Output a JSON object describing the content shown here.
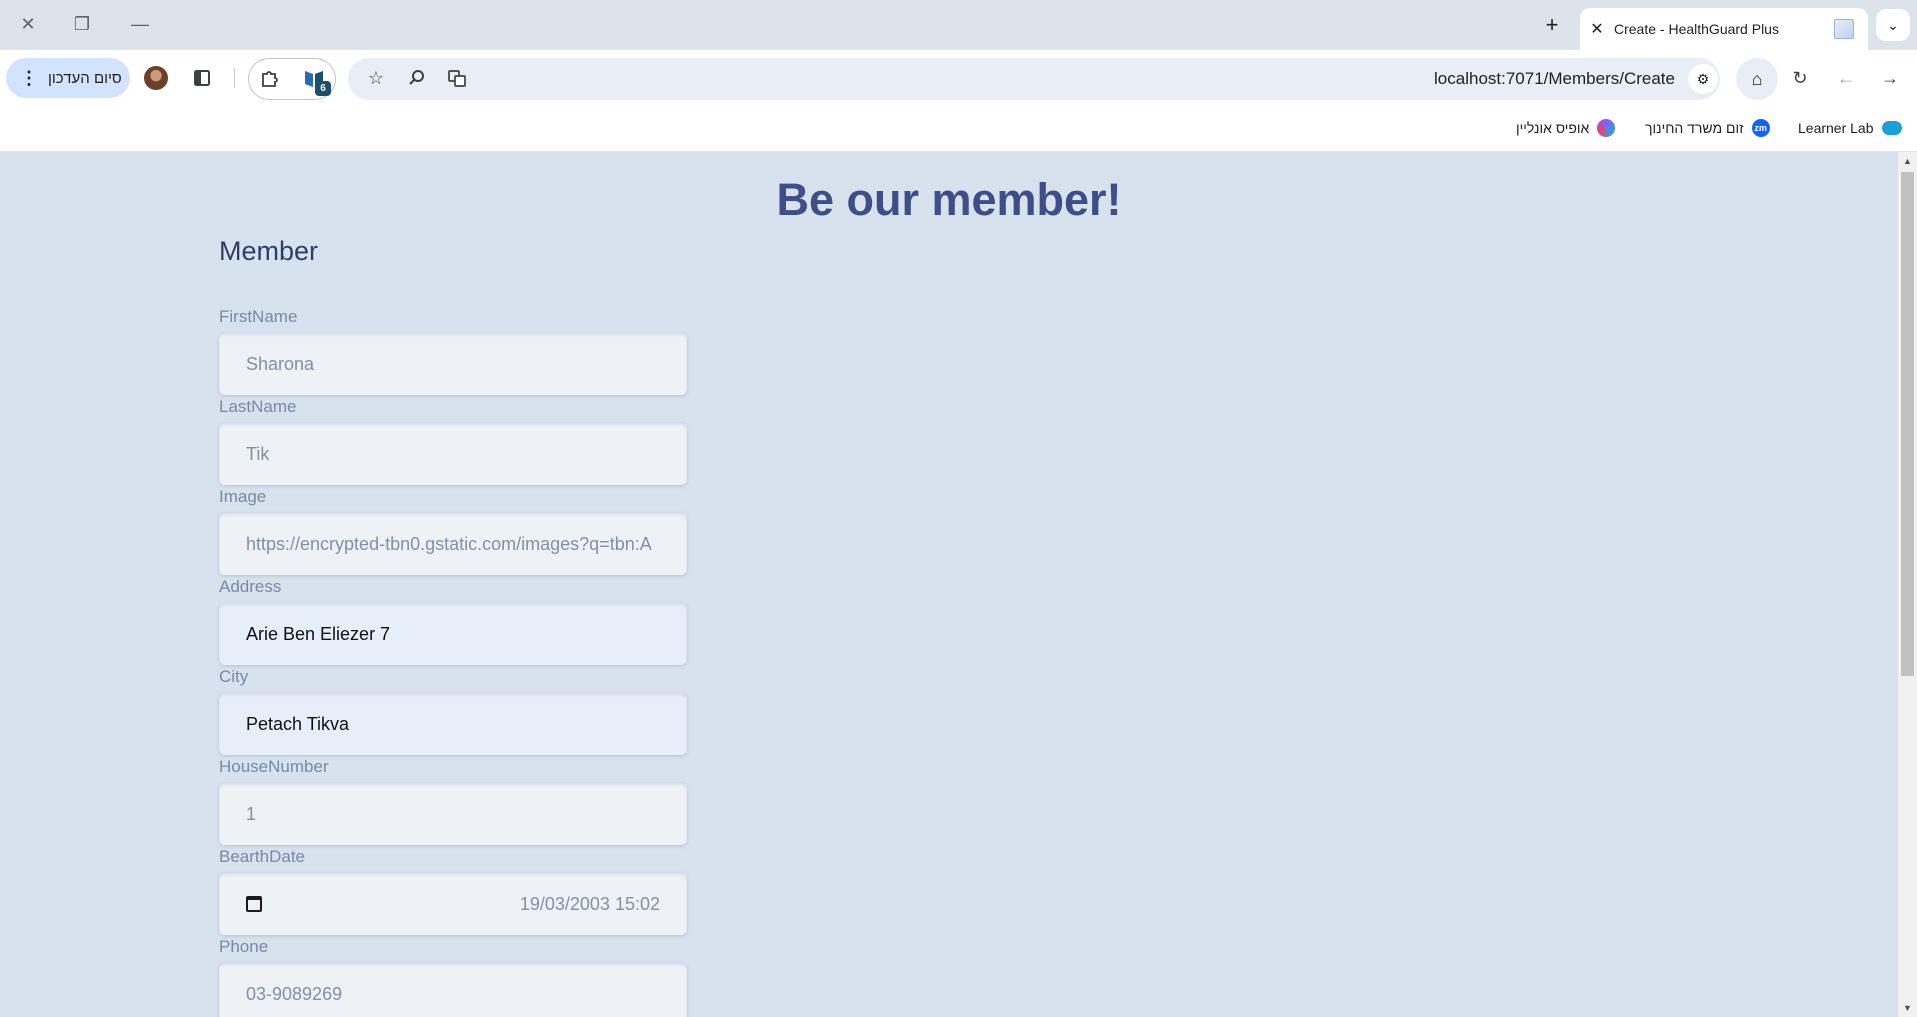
{
  "browser": {
    "tab": {
      "title": "Create - HealthGuard Plus"
    },
    "url": "localhost:7071/Members/Create",
    "update_button_label": "סיום העדכון",
    "extension_badge_count": "6",
    "bookmarks": [
      {
        "label": "Learner Lab",
        "icon": "cloud-icon",
        "color": "#1a9fd9"
      },
      {
        "label": "זום משרד החינוך",
        "icon": "zm-icon",
        "color": "#1463f3"
      },
      {
        "label": "אופיס אונליין",
        "icon": "office-icon",
        "color": "#8a5cf6"
      }
    ]
  },
  "page": {
    "title": "Be our member!",
    "section": "Member",
    "fields": [
      {
        "label": "FirstName",
        "value": "Sharona"
      },
      {
        "label": "LastName",
        "value": "Tik"
      },
      {
        "label": "Image",
        "value": "https://encrypted-tbn0.gstatic.com/images?q=tbn:A"
      },
      {
        "label": "Address",
        "value": "Arie Ben Eliezer 7"
      },
      {
        "label": "City",
        "value": "Petach Tikva"
      },
      {
        "label": "HouseNumber",
        "value": "1"
      },
      {
        "label": "BearthDate",
        "value": "19/03/2003  15:02"
      },
      {
        "label": "Phone",
        "value": "03-9089269"
      }
    ]
  },
  "colors": {
    "page_bg": "#d8e1ee",
    "title": "#3d4f86",
    "label": "#7989a5"
  }
}
